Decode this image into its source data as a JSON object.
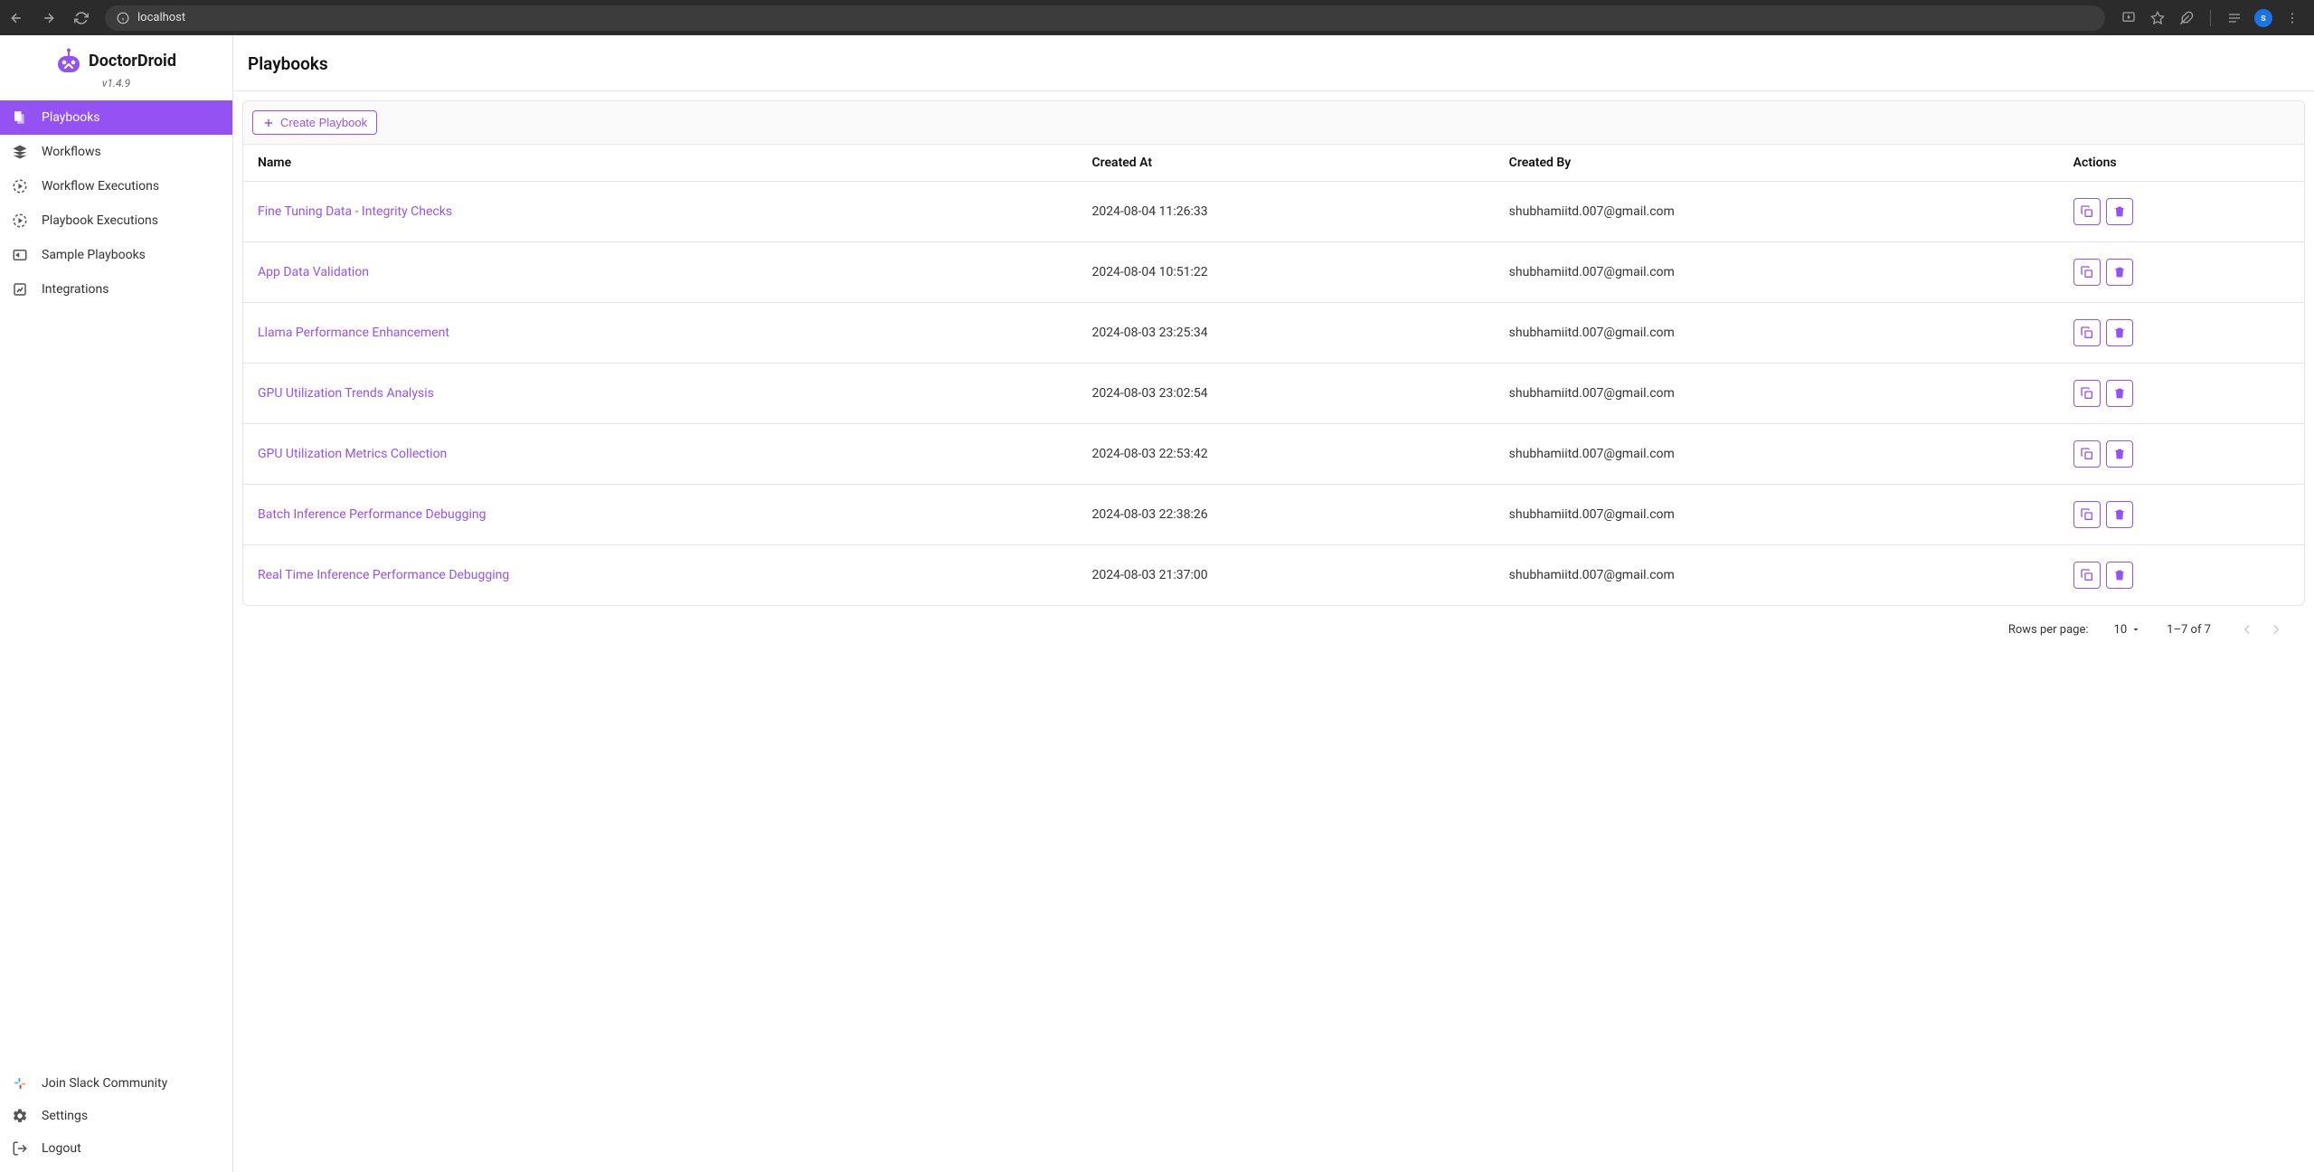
{
  "browser": {
    "url": "localhost",
    "avatar": "s"
  },
  "app": {
    "name": "DoctorDroid",
    "version": "v1.4.9"
  },
  "sidebar": {
    "items": [
      {
        "label": "Playbooks"
      },
      {
        "label": "Workflows"
      },
      {
        "label": "Workflow Executions"
      },
      {
        "label": "Playbook Executions"
      },
      {
        "label": "Sample Playbooks"
      },
      {
        "label": "Integrations"
      }
    ],
    "footer": [
      {
        "label": "Join Slack Community"
      },
      {
        "label": "Settings"
      },
      {
        "label": "Logout"
      }
    ]
  },
  "page": {
    "title": "Playbooks",
    "create_btn": "Create Playbook"
  },
  "table": {
    "headers": [
      "Name",
      "Created At",
      "Created By",
      "Actions"
    ],
    "rows": [
      {
        "name": "Fine Tuning Data - Integrity Checks",
        "created_at": "2024-08-04 11:26:33",
        "created_by": "shubhamiitd.007@gmail.com"
      },
      {
        "name": "App Data Validation",
        "created_at": "2024-08-04 10:51:22",
        "created_by": "shubhamiitd.007@gmail.com"
      },
      {
        "name": "Llama Performance Enhancement",
        "created_at": "2024-08-03 23:25:34",
        "created_by": "shubhamiitd.007@gmail.com"
      },
      {
        "name": "GPU Utilization Trends Analysis",
        "created_at": "2024-08-03 23:02:54",
        "created_by": "shubhamiitd.007@gmail.com"
      },
      {
        "name": "GPU Utilization Metrics Collection",
        "created_at": "2024-08-03 22:53:42",
        "created_by": "shubhamiitd.007@gmail.com"
      },
      {
        "name": "Batch Inference Performance Debugging",
        "created_at": "2024-08-03 22:38:26",
        "created_by": "shubhamiitd.007@gmail.com"
      },
      {
        "name": "Real Time Inference Performance Debugging",
        "created_at": "2024-08-03 21:37:00",
        "created_by": "shubhamiitd.007@gmail.com"
      }
    ]
  },
  "pagination": {
    "rows_per_page_label": "Rows per page:",
    "rows_per_page_value": "10",
    "range": "1–7 of 7"
  }
}
